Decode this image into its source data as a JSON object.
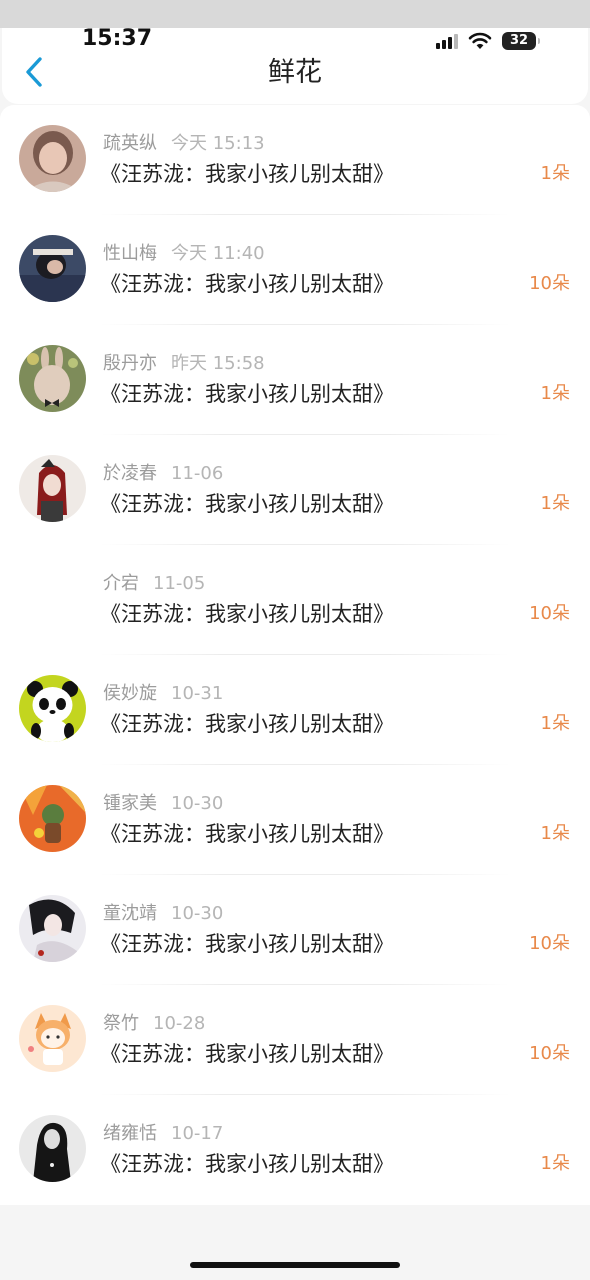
{
  "status_bar": {
    "time": "15:37",
    "battery": "32"
  },
  "header": {
    "title": "鲜花"
  },
  "items": [
    {
      "name": "疏英纵",
      "time": "今天 15:13",
      "book": "《汪苏泷：我家小孩儿别太甜》",
      "count": "1朵"
    },
    {
      "name": "性山梅",
      "time": "今天 11:40",
      "book": "《汪苏泷：我家小孩儿别太甜》",
      "count": "10朵"
    },
    {
      "name": "殷丹亦",
      "time": "昨天 15:58",
      "book": "《汪苏泷：我家小孩儿别太甜》",
      "count": "1朵"
    },
    {
      "name": "於凌春",
      "time": "11-06",
      "book": "《汪苏泷：我家小孩儿别太甜》",
      "count": "1朵"
    },
    {
      "name": "介宕",
      "time": "11-05",
      "book": "《汪苏泷：我家小孩儿别太甜》",
      "count": "10朵"
    },
    {
      "name": "侯妙旋",
      "time": "10-31",
      "book": "《汪苏泷：我家小孩儿别太甜》",
      "count": "1朵"
    },
    {
      "name": "锺家美",
      "time": "10-30",
      "book": "《汪苏泷：我家小孩儿别太甜》",
      "count": "1朵"
    },
    {
      "name": "童沈靖",
      "time": "10-30",
      "book": "《汪苏泷：我家小孩儿别太甜》",
      "count": "10朵"
    },
    {
      "name": "祭竹",
      "time": "10-28",
      "book": "《汪苏泷：我家小孩儿别太甜》",
      "count": "10朵"
    },
    {
      "name": "绪雍恬",
      "time": "10-17",
      "book": "《汪苏泷：我家小孩儿别太甜》",
      "count": "1朵"
    }
  ],
  "colors": {
    "accent": "#1a9ad6",
    "count": "#e8894a"
  }
}
